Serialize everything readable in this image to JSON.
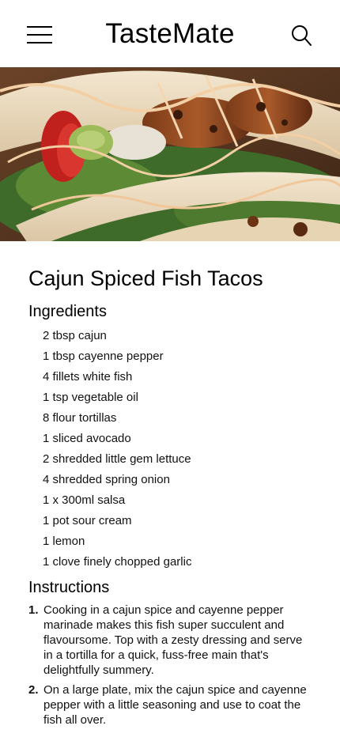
{
  "header": {
    "title": "TasteMate",
    "menu_icon": "hamburger-menu-icon",
    "search_icon": "search-icon"
  },
  "hero": {
    "image": "fish-tacos-photo"
  },
  "recipe": {
    "title": "Cajun Spiced Fish Tacos",
    "ingredients_heading": "Ingredients",
    "ingredients": [
      "2 tbsp cajun",
      "1 tbsp cayenne pepper",
      "4 fillets white fish",
      "1 tsp vegetable oil",
      "8 flour tortillas",
      "1 sliced avocado",
      "2 shredded little gem lettuce",
      "4 shredded spring onion",
      "1 x 300ml salsa",
      "1 pot sour cream",
      "1 lemon",
      "1 clove finely chopped garlic"
    ],
    "instructions_heading": "Instructions",
    "instructions": [
      {
        "number": "1.",
        "text": "Cooking in a cajun spice and cayenne pepper marinade makes this fish super succulent and flavoursome. Top with a zesty dressing and serve in a tortilla for a quick, fuss-free main that's delightfully summery."
      },
      {
        "number": "2.",
        "text": "On a large plate, mix the cajun spice and cayenne pepper with a little seasoning and use to coat the fish all over."
      }
    ]
  },
  "colors": {
    "background": "#ffffff",
    "text": "#111111",
    "title": "#000000"
  }
}
